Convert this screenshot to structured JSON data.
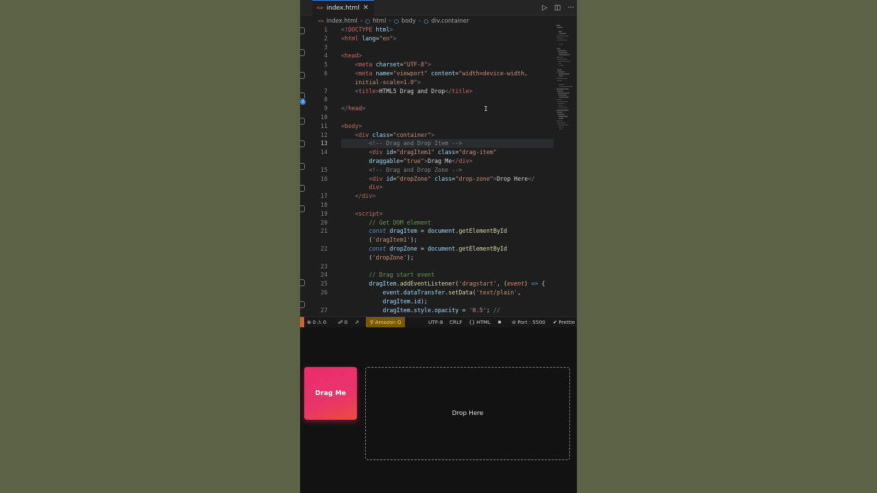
{
  "tab": {
    "file_name": "index.html",
    "close": "✕",
    "icon": "code-icon"
  },
  "tab_actions": [
    "run-icon",
    "split-editor-icon",
    "more-icon"
  ],
  "breadcrumb": {
    "file": "index.html",
    "items": [
      "html",
      "body",
      "div.container"
    ]
  },
  "editor": {
    "current_line": 13,
    "lines": [
      {
        "n": "1",
        "html": "<span class=\"t-br\">&lt;!</span><span class=\"t-tag\">DOCTYPE</span> <span class=\"t-attr\">html</span><span class=\"t-br\">&gt;</span>"
      },
      {
        "n": "2",
        "html": "<span class=\"t-br\">&lt;</span><span class=\"t-tag\">html</span> <span class=\"t-attr\">lang</span>=<span class=\"t-str\">\"en\"</span><span class=\"t-br\">&gt;</span>"
      },
      {
        "n": "3",
        "html": ""
      },
      {
        "n": "4",
        "html": "<span class=\"t-br\">&lt;</span><span class=\"t-tag\">head</span><span class=\"t-br\">&gt;</span>"
      },
      {
        "n": "5",
        "html": "    <span class=\"t-br\">&lt;</span><span class=\"t-tag\">meta</span> <span class=\"t-attr\">charset</span>=<span class=\"t-str\">\"UTF-8\"</span><span class=\"t-br\">&gt;</span>"
      },
      {
        "n": "6",
        "html": "    <span class=\"t-br\">&lt;</span><span class=\"t-tag\">meta</span> <span class=\"t-attr\">name</span>=<span class=\"t-str\">\"viewport\"</span> <span class=\"t-attr\">content</span>=<span class=\"t-str\">\"width=device-width,</span>"
      },
      {
        "n": "",
        "html": "    <span class=\"t-str\">initial-scale=1.0\"</span><span class=\"t-br\">&gt;</span>"
      },
      {
        "n": "7",
        "html": "    <span class=\"t-br\">&lt;</span><span class=\"t-tag\">title</span><span class=\"t-br\">&gt;</span>HTML5 Drag and Drop<span class=\"t-br\">&lt;/</span><span class=\"t-tag\">title</span><span class=\"t-br\">&gt;</span>"
      },
      {
        "n": "8",
        "html": ""
      },
      {
        "n": "9",
        "html": "<span class=\"t-br\">&lt;/</span><span class=\"t-tag\">head</span><span class=\"t-br\">&gt;</span>"
      },
      {
        "n": "10",
        "html": ""
      },
      {
        "n": "11",
        "html": "<span class=\"t-br\">&lt;</span><span class=\"t-tag\">body</span><span class=\"t-br\">&gt;</span>"
      },
      {
        "n": "12",
        "html": "    <span class=\"t-br\">&lt;</span><span class=\"t-tag\">div</span> <span class=\"t-attr\">class</span>=<span class=\"t-str\">\"container\"</span><span class=\"t-br\">&gt;</span>"
      },
      {
        "n": "13",
        "html": "        <span class=\"t-br\">&lt;!-- Drag and Drop Item --&gt;</span>"
      },
      {
        "n": "14",
        "html": "        <span class=\"t-br\">&lt;</span><span class=\"t-tag\">div</span> <span class=\"t-attr\">id</span>=<span class=\"t-str\">\"dragItem1\"</span> <span class=\"t-attr\">class</span>=<span class=\"t-str\">\"drag-item\"</span>"
      },
      {
        "n": "",
        "html": "        <span class=\"t-attr\">draggable</span>=<span class=\"t-str\">\"true\"</span><span class=\"t-br\">&gt;</span>Drag Me<span class=\"t-br\">&lt;/</span><span class=\"t-tag\">div</span><span class=\"t-br\">&gt;</span>"
      },
      {
        "n": "15",
        "html": "        <span class=\"t-br\">&lt;!-- Drag and Drop Zone --&gt;</span>"
      },
      {
        "n": "16",
        "html": "        <span class=\"t-br\">&lt;</span><span class=\"t-tag\">div</span> <span class=\"t-attr\">id</span>=<span class=\"t-str\">\"dropZone\"</span> <span class=\"t-attr\">class</span>=<span class=\"t-str\">\"drop-zone\"</span><span class=\"t-br\">&gt;</span>Drop Here<span class=\"t-br\">&lt;/</span>"
      },
      {
        "n": "",
        "html": "        <span class=\"t-tag\">div</span><span class=\"t-br\">&gt;</span>"
      },
      {
        "n": "17",
        "html": "    <span class=\"t-br\">&lt;/</span><span class=\"t-tag\">div</span><span class=\"t-br\">&gt;</span>"
      },
      {
        "n": "18",
        "html": ""
      },
      {
        "n": "19",
        "html": "    <span class=\"t-br\">&lt;</span><span class=\"t-tag\">script</span><span class=\"t-br\">&gt;</span>"
      },
      {
        "n": "20",
        "html": "        <span class=\"t-cm\">// Get DOM element</span>"
      },
      {
        "n": "21",
        "html": "        <span class=\"t-kw\">const</span> <span class=\"t-var\">dragItem</span> <span class=\"t-op\">=</span> <span class=\"t-var\">document</span>.<span class=\"t-fn\">getElementById</span>"
      },
      {
        "n": "",
        "html": "        (<span class=\"t-str\">'dragItem1'</span>);"
      },
      {
        "n": "22",
        "html": "        <span class=\"t-kw\">const</span> <span class=\"t-var\">dropZone</span> <span class=\"t-op\">=</span> <span class=\"t-var\">document</span>.<span class=\"t-fn\">getElementById</span>"
      },
      {
        "n": "",
        "html": "        (<span class=\"t-str\">'dropZone'</span>);"
      },
      {
        "n": "23",
        "html": ""
      },
      {
        "n": "24",
        "html": "        <span class=\"t-cm\">// Drag start event</span>"
      },
      {
        "n": "25",
        "html": "        <span class=\"t-var\">dragItem</span>.<span class=\"t-fn\">addEventListener</span>(<span class=\"t-str\">'dragstart'</span>, (<span class=\"t-par\">event</span>) <span class=\"t-kw\">=&gt;</span> {"
      },
      {
        "n": "26",
        "html": "            <span class=\"t-var\">event</span>.<span class=\"t-var\">dataTransfer</span>.<span class=\"t-fn\">setData</span>(<span class=\"t-str\">'text/plain'</span>,"
      },
      {
        "n": "",
        "html": "            <span class=\"t-var\">dragItem</span>.<span class=\"t-var\">id</span>);"
      },
      {
        "n": "27",
        "html": "            <span class=\"t-var\">dragItem</span>.<span class=\"t-var\">style</span>.<span class=\"t-var\">opacity</span> <span class=\"t-op\">=</span> <span class=\"t-str\">'0.5'</span>; <span class=\"t-cm\">//</span>"
      }
    ]
  },
  "statusbar": {
    "errors": "0",
    "warnings": "0",
    "ports": "0",
    "amazon_q": "Amazon Q",
    "encoding": "UTF-8",
    "eol": "CRLF",
    "language": "HTML",
    "port": "Port : 5500",
    "prettier": "Prettie"
  },
  "preview": {
    "drag_label": "Drag Me",
    "drop_label": "Drop Here"
  },
  "colors": {
    "accent": "#3b86ff",
    "drag_item": "#ea2c6c",
    "status_remote": "#d1622c",
    "amazon_q_bg": "#7a5a00"
  }
}
